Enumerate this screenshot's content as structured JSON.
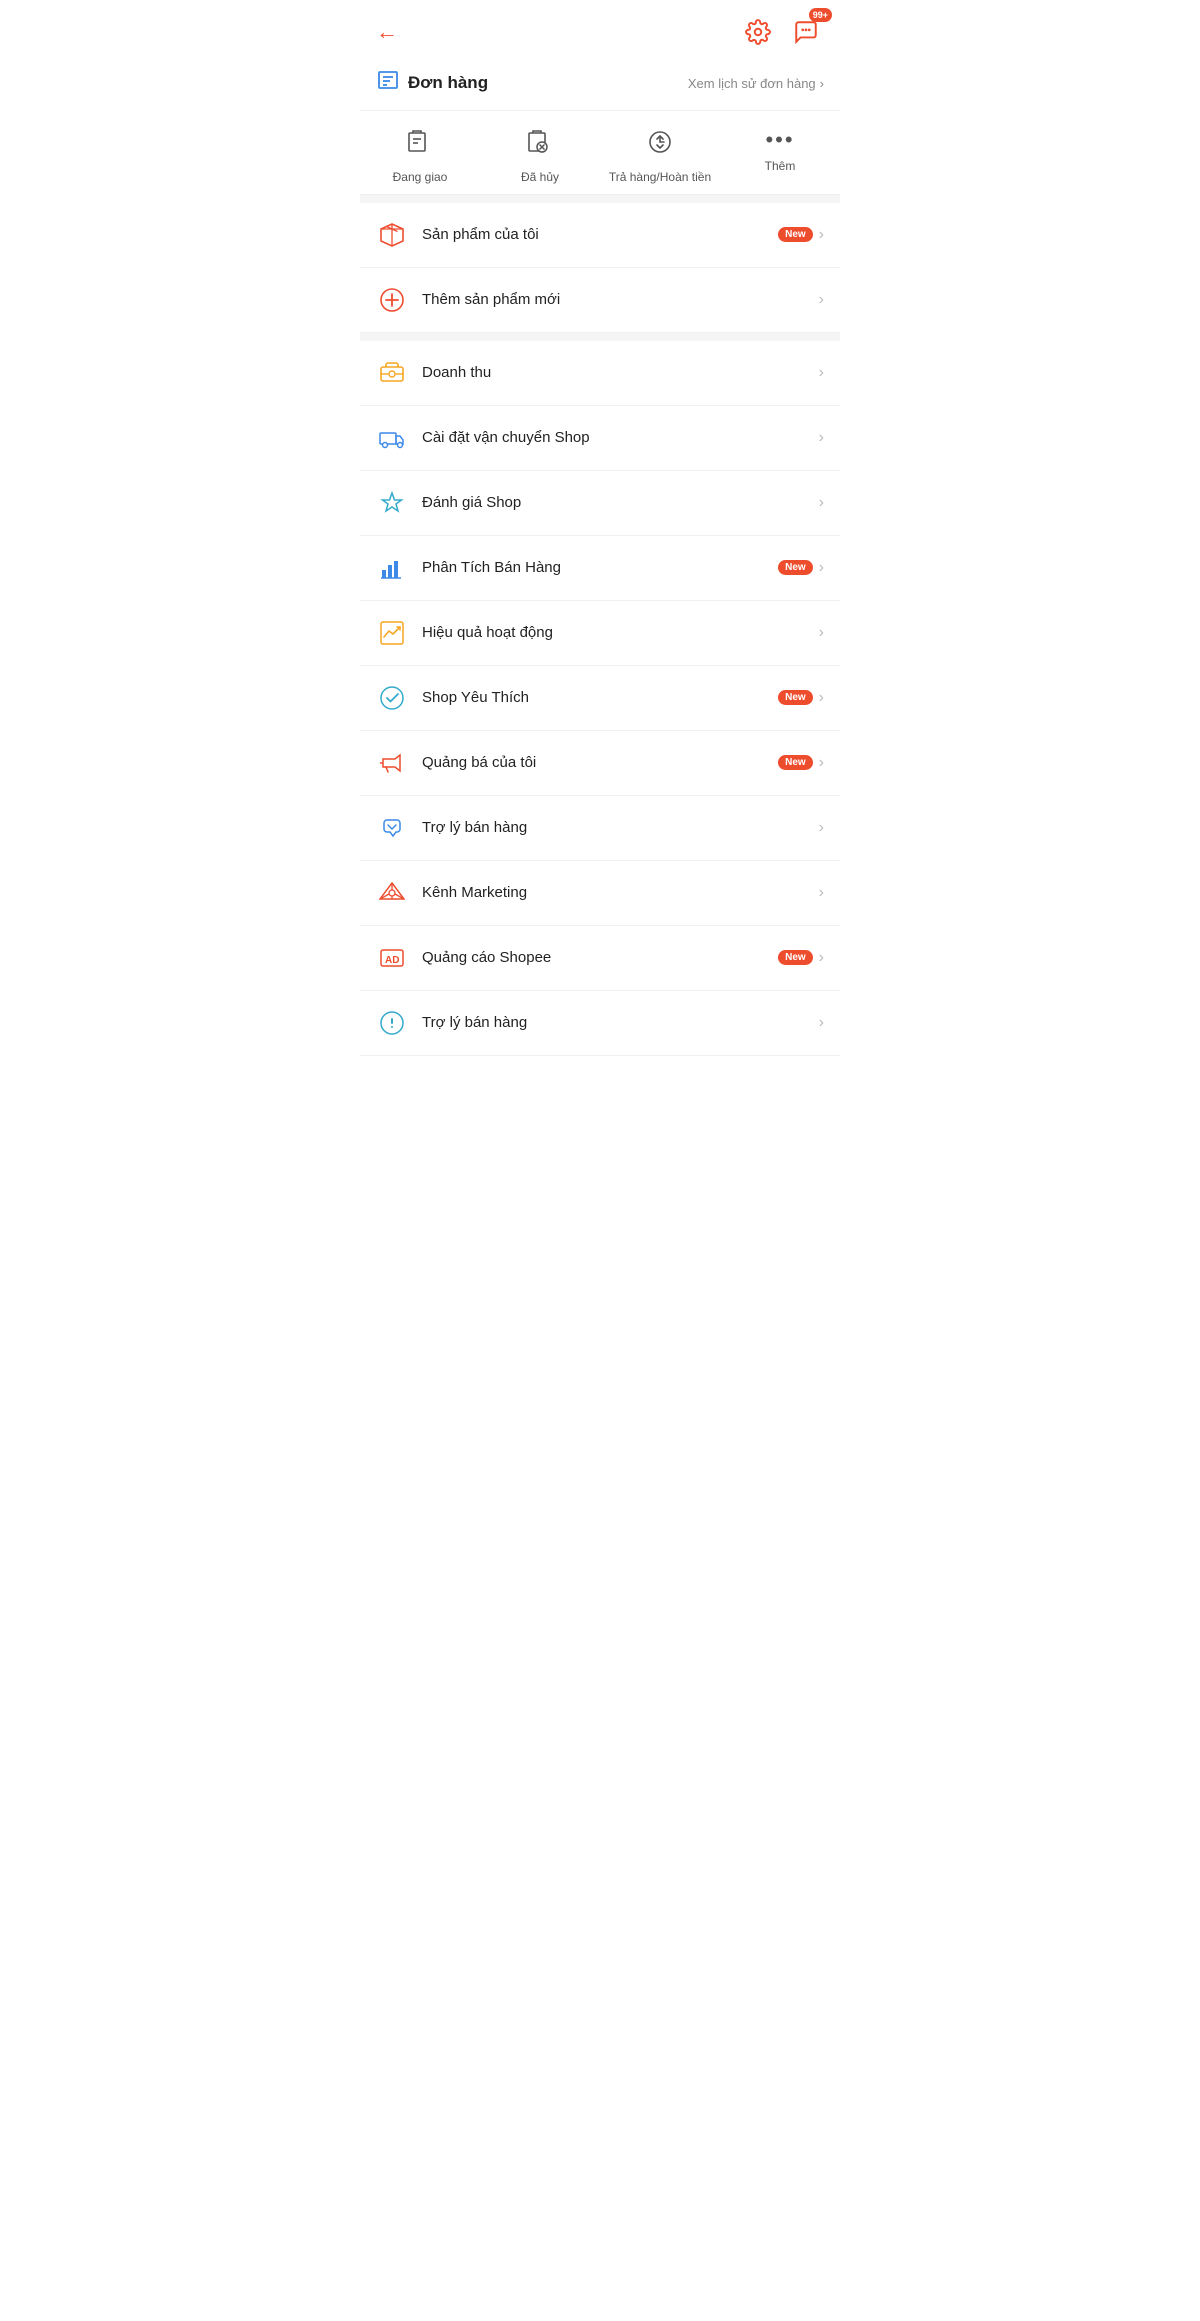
{
  "header": {
    "back_label": "←",
    "gear_label": "⚙",
    "chat_badge": "99+",
    "chat_label": "💬"
  },
  "order_section": {
    "title": "Đơn hàng",
    "view_history": "Xem lịch sử đơn hàng",
    "tabs": [
      {
        "id": "dang-giao",
        "label": "Đang giao"
      },
      {
        "id": "da-huy",
        "label": "Đã hủy"
      },
      {
        "id": "tra-hang",
        "label": "Trả hàng/Hoàn tiền"
      },
      {
        "id": "them",
        "label": "Thêm"
      }
    ]
  },
  "menu_group1": [
    {
      "id": "san-pham-cua-toi",
      "label": "Sản phẩm của tôi",
      "has_badge": true,
      "badge_text": "New"
    },
    {
      "id": "them-san-pham-moi",
      "label": "Thêm sản phẩm mới",
      "has_badge": false
    }
  ],
  "menu_group2": [
    {
      "id": "doanh-thu",
      "label": "Doanh thu",
      "has_badge": false
    },
    {
      "id": "cai-dat-van-chuyen",
      "label": "Cài đặt vận chuyển Shop",
      "has_badge": false
    },
    {
      "id": "danh-gia-shop",
      "label": "Đánh giá Shop",
      "has_badge": false
    },
    {
      "id": "phan-tich-ban-hang",
      "label": "Phân Tích Bán Hàng",
      "has_badge": true,
      "badge_text": "New"
    },
    {
      "id": "hieu-qua-hoat-dong",
      "label": "Hiệu quả hoạt động",
      "has_badge": false
    },
    {
      "id": "shop-yeu-thich",
      "label": "Shop Yêu Thích",
      "has_badge": true,
      "badge_text": "New"
    },
    {
      "id": "quang-ba-cua-toi",
      "label": "Quảng bá của tôi",
      "has_badge": true,
      "badge_text": "New"
    },
    {
      "id": "tro-ly-ban-hang-1",
      "label": "Trợ lý bán hàng",
      "has_badge": false
    },
    {
      "id": "kenh-marketing",
      "label": "Kênh Marketing",
      "has_badge": false
    },
    {
      "id": "quang-cao-shopee",
      "label": "Quảng cáo Shopee",
      "has_badge": true,
      "badge_text": "New"
    },
    {
      "id": "tro-ly-ban-hang-2",
      "label": "Trợ lý bán hàng",
      "has_badge": false
    }
  ]
}
